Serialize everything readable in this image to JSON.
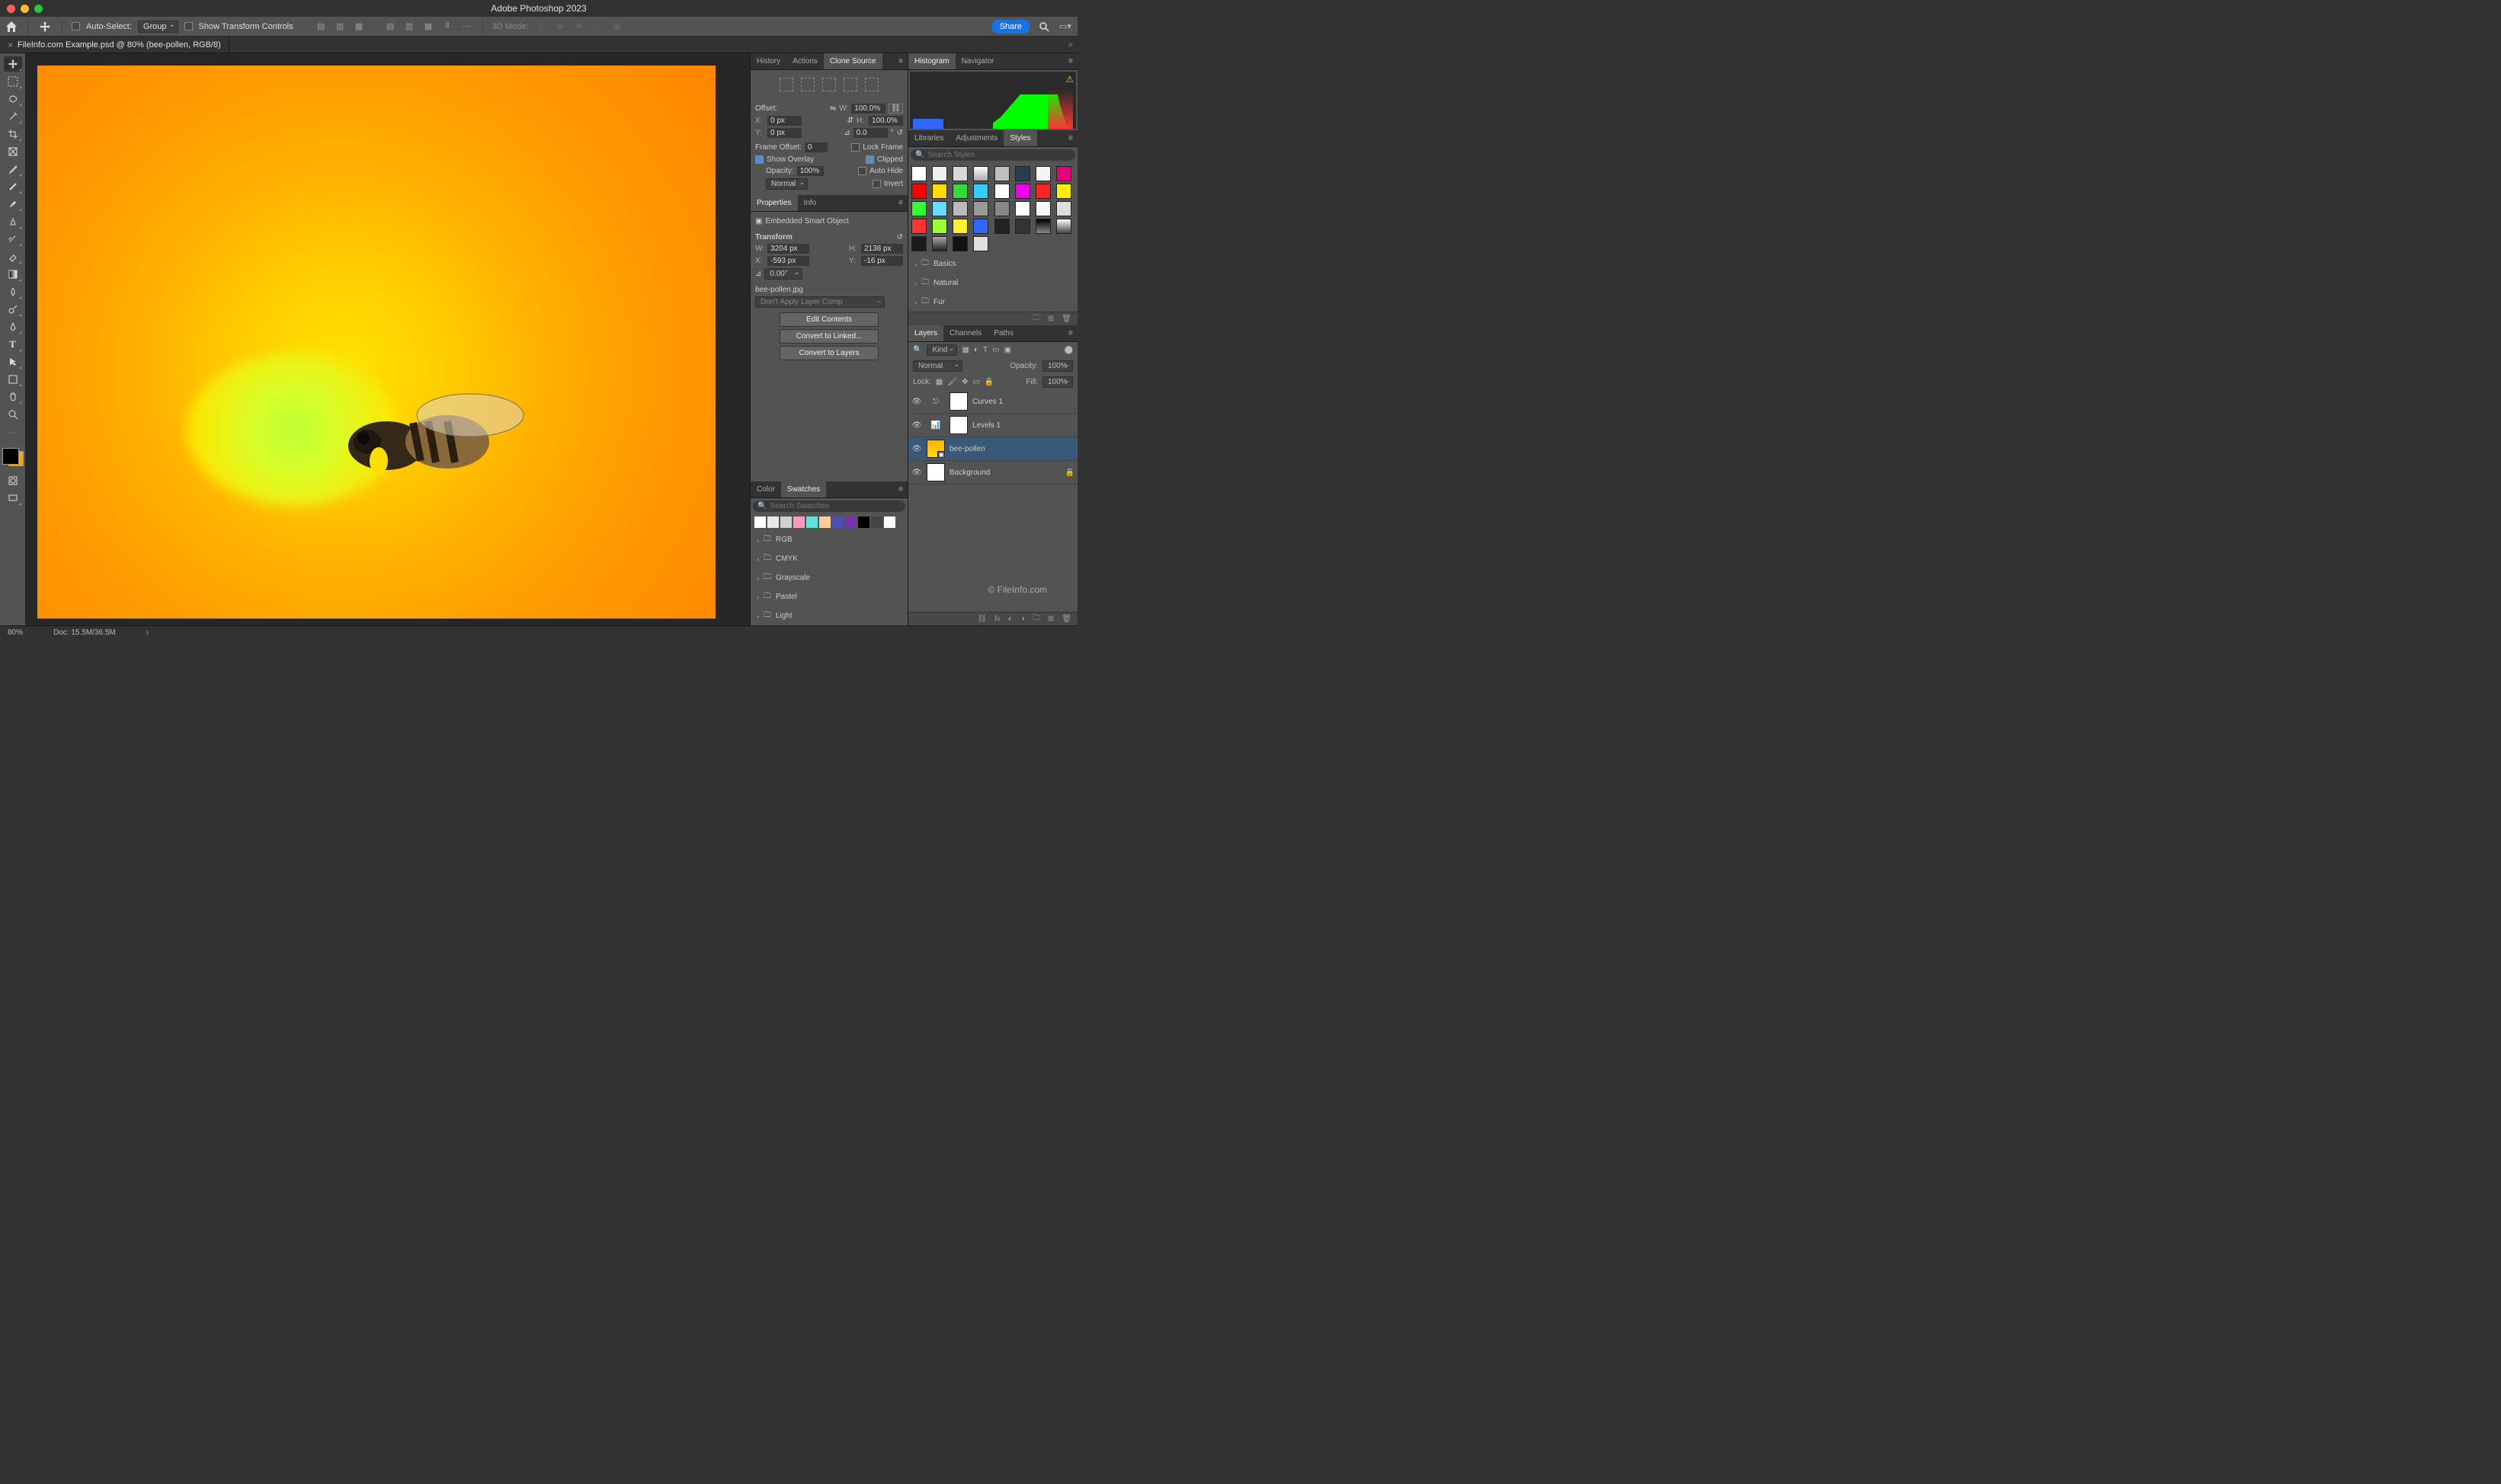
{
  "app": {
    "title": "Adobe Photoshop 2023"
  },
  "optionsbar": {
    "auto_select_label": "Auto-Select:",
    "auto_select_target": "Group",
    "show_transform": "Show Transform Controls",
    "mode3d": "3D Mode:",
    "share": "Share"
  },
  "document": {
    "tab": "FileInfo.com Example.psd @ 80% (bee-pollen, RGB/8)"
  },
  "panels_left": {
    "history": "History",
    "actions": "Actions",
    "clone_source": "Clone Source"
  },
  "clone_source": {
    "offset_label": "Offset:",
    "x_label": "X:",
    "x_value": "0 px",
    "y_label": "Y:",
    "y_value": "0 px",
    "w_label": "W:",
    "w_value": "100.0%",
    "h_label": "H:",
    "h_value": "100.0%",
    "angle_value": "0.0",
    "frame_offset_label": "Frame Offset:",
    "frame_offset_value": "0",
    "lock_frame": "Lock Frame",
    "show_overlay": "Show Overlay",
    "opacity_label": "Opacity:",
    "opacity_value": "100%",
    "blend_mode": "Normal",
    "clipped": "Clipped",
    "auto_hide": "Auto Hide",
    "invert": "Invert"
  },
  "properties": {
    "tab_properties": "Properties",
    "tab_info": "Info",
    "object_type": "Embedded Smart Object",
    "transform_label": "Transform",
    "w_label": "W:",
    "w_value": "3204 px",
    "h_label": "H:",
    "h_value": "2138 px",
    "x_label": "X:",
    "x_value": "-593 px",
    "y_label": "Y:",
    "y_value": "-16 px",
    "angle_value": "0.00°",
    "linked_file": "bee-pollen.jpg",
    "layer_comp": "Don't Apply Layer Comp",
    "edit_contents": "Edit Contents",
    "convert_linked": "Convert to Linked...",
    "convert_layers": "Convert to Layers"
  },
  "color_panel": {
    "tab_color": "Color",
    "tab_swatches": "Swatches",
    "search_placeholder": "Search Swatches",
    "folders": [
      "RGB",
      "CMYK",
      "Grayscale",
      "Pastel",
      "Light"
    ],
    "recent": [
      "#ffffff",
      "#e8e8e8",
      "#d0d0d0",
      "#ff99bb",
      "#66dddd",
      "#ffcc99",
      "#4d4db3",
      "#7733aa",
      "#000000",
      "#444444",
      "#ffffff"
    ]
  },
  "right": {
    "histogram": "Histogram",
    "navigator": "Navigator",
    "libraries": "Libraries",
    "adjustments": "Adjustments",
    "styles": "Styles",
    "styles_search": "Search Styles",
    "style_folders": [
      "Basics",
      "Natural",
      "Fur"
    ],
    "style_swatches": [
      "#ffffff",
      "#f0f0f0",
      "#d8d8d8",
      "linear-gradient(#fff,#aaa)",
      "#c0c0c0",
      "#2a3a55",
      "#f5f5f5",
      "#e6007a",
      "#ff0000",
      "#ffdd00",
      "#33dd33",
      "#33ccff",
      "#ffffff",
      "#ee00ee",
      "#ff2222",
      "#ffee00",
      "#33ff33",
      "#66ddff",
      "#bbbbbb",
      "#999999",
      "#888888",
      "#ffffff",
      "#f8f8f8",
      "#dddddd",
      "#ff3333",
      "#99ff33",
      "#ffee33",
      "#3366ff",
      "#222222",
      "#333333",
      "linear-gradient(#000,#888)",
      "linear-gradient(#fff,#444)",
      "#1a1a1a",
      "linear-gradient(#aaa,#222)",
      "#111111",
      "#e0e0e0"
    ],
    "layers_tab": "Layers",
    "channels_tab": "Channels",
    "paths_tab": "Paths",
    "layer_filter": "Kind",
    "blend": "Normal",
    "opacity_label": "Opacity:",
    "opacity_value": "100%",
    "lock_label": "Lock:",
    "fill_label": "Fill:",
    "fill_value": "100%",
    "layers": [
      {
        "name": "Curves 1",
        "type": "adjustment"
      },
      {
        "name": "Levels 1",
        "type": "adjustment"
      },
      {
        "name": "bee-pollen",
        "type": "smartobj",
        "selected": true
      },
      {
        "name": "Background",
        "type": "locked"
      }
    ],
    "watermark": "© FileInfo.com"
  },
  "statusbar": {
    "zoom": "80%",
    "doc": "Doc: 15.5M/36.5M"
  }
}
